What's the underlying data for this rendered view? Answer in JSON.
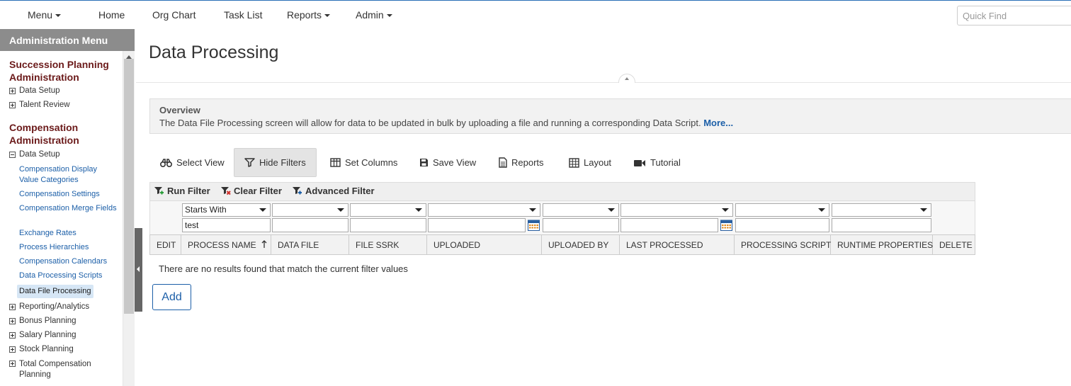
{
  "topnav": {
    "menu": "Menu",
    "home": "Home",
    "org_chart": "Org Chart",
    "task_list": "Task List",
    "reports": "Reports",
    "admin": "Admin",
    "quick_find_placeholder": "Quick Find"
  },
  "sidebar": {
    "header": "Administration Menu",
    "sections": [
      {
        "title": "Succession Planning Administration",
        "nodes": [
          "Data Setup",
          "Talent Review"
        ]
      },
      {
        "title": "Compensation Administration",
        "expanded_node": "Data Setup",
        "links": [
          "Compensation Display Value Categories",
          "Compensation Settings",
          "Compensation Merge Fields",
          "Exchange Rates",
          "Process Hierarchies",
          "Compensation Calendars",
          "Data Processing Scripts",
          "Data File Processing"
        ],
        "active_link": "Data File Processing",
        "nodes": [
          "Reporting/Analytics",
          "Bonus Planning",
          "Salary Planning",
          "Stock Planning",
          "Total Compensation Planning"
        ]
      }
    ]
  },
  "page": {
    "title": "Data Processing",
    "overview_title": "Overview",
    "overview_text": "The Data File Processing screen will allow for data to be updated in bulk by uploading a file and running a corresponding Data Script.",
    "overview_more": "More..."
  },
  "toolbar": {
    "select_view": "Select View",
    "hide_filters": "Hide Filters",
    "set_columns": "Set Columns",
    "save_view": "Save View",
    "reports": "Reports",
    "layout": "Layout",
    "tutorial": "Tutorial"
  },
  "filter_bar": {
    "run_filter": "Run Filter",
    "clear_filter": "Clear Filter",
    "advanced_filter": "Advanced Filter"
  },
  "filters": {
    "process_name_operator": "Starts With",
    "process_name_value": "test"
  },
  "grid": {
    "columns": [
      "EDIT",
      "PROCESS NAME",
      "DATA FILE",
      "FILE SSRK",
      "UPLOADED",
      "UPLOADED BY",
      "LAST PROCESSED",
      "PROCESSING SCRIPT",
      "RUNTIME PROPERTIES",
      "DELETE"
    ],
    "empty_message": "There are no results found that match the current filter values",
    "add_label": "Add"
  },
  "colors": {
    "section_title": "#6b1a1a",
    "link": "#1c5fa8",
    "sidebar_header": "#8c8c8c",
    "nav_border": "#2a6fb6"
  }
}
